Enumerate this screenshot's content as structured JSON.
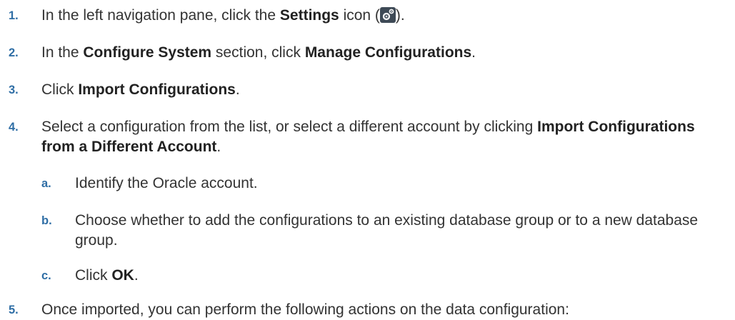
{
  "steps": [
    {
      "number": "1.",
      "t1": "In the left navigation pane, click the ",
      "b1": "Settings",
      "t2": " icon (",
      "icon": "settings-gear-icon",
      "t3": ")."
    },
    {
      "number": "2.",
      "t1": "In the ",
      "b1": "Configure System",
      "t2": " section, click ",
      "b2": "Manage Configurations",
      "t3": "."
    },
    {
      "number": "3.",
      "t1": "Click ",
      "b1": "Import Configurations",
      "t2": "."
    },
    {
      "number": "4.",
      "t1": "Select a configuration from the list, or select a different account by clicking ",
      "b1": "Import Configurations from a Different Account",
      "t2": ".",
      "substeps": [
        {
          "letter": "a.",
          "t1": "Identify the Oracle account."
        },
        {
          "letter": "b.",
          "t1": "Choose whether to add the configurations to an existing database group or to a new database group."
        },
        {
          "letter": "c.",
          "t1": "Click ",
          "b1": "OK",
          "t2": "."
        }
      ]
    },
    {
      "number": "5.",
      "t1": "Once imported, you can perform the following actions on the data configuration:"
    }
  ],
  "colors": {
    "number": "#2f6ea5",
    "text": "#333333",
    "icon_bg": "#3e4a56"
  }
}
